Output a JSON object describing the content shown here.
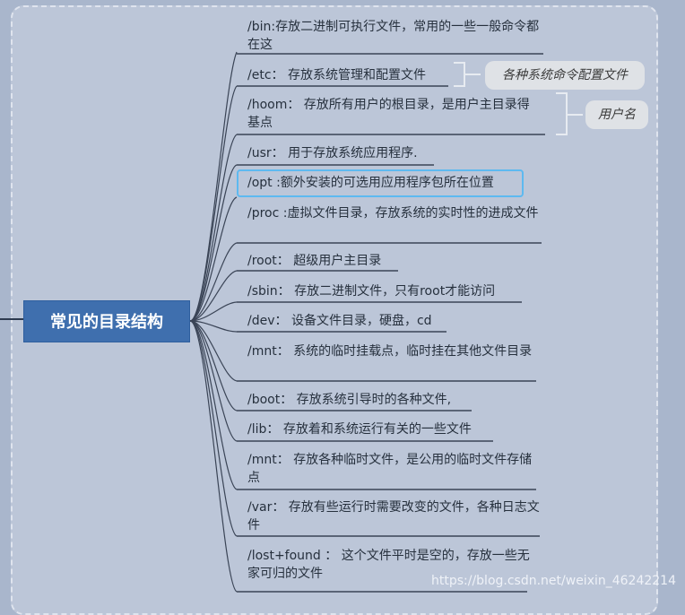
{
  "central_topic": "常见的目录结构",
  "items": [
    "/bin:存放二进制可执行文件，常用的一些一般命令都在这",
    "/etc： 存放系统管理和配置文件",
    "/hoom： 存放所有用户的根目录，是用户主目录得基点",
    "/usr： 用于存放系统应用程序.",
    "/opt :额外安装的可选用应用程序包所在位置",
    "/proc :虚拟文件目录，存放系统的实时性的进成文件",
    "/root： 超级用户主目录",
    "/sbin： 存放二进制文件，只有root才能访问",
    "/dev： 设备文件目录，硬盘，cd",
    "/mnt： 系统的临时挂载点，临时挂在其他文件目录",
    "/boot： 存放系统引导时的各种文件,",
    "/lib： 存放着和系统运行有关的一些文件",
    "/mnt： 存放各种临时文件，是公用的临时文件存储点",
    "/var： 存放有些运行时需要改变的文件，各种日志文件",
    "/lost+found ： 这个文件平时是空的，存放一些无家可归的文件"
  ],
  "callouts": {
    "etc": "各种系统命令配置文件",
    "hoom": "用户名"
  },
  "watermark": "https://blog.csdn.net/weixin_46242214",
  "colors": {
    "background": "#a9b6cc",
    "panel": "#bcc6d8",
    "central_fill": "#3f6fae",
    "highlight": "#5db9f0",
    "callout_fill": "#dfe2e6"
  }
}
